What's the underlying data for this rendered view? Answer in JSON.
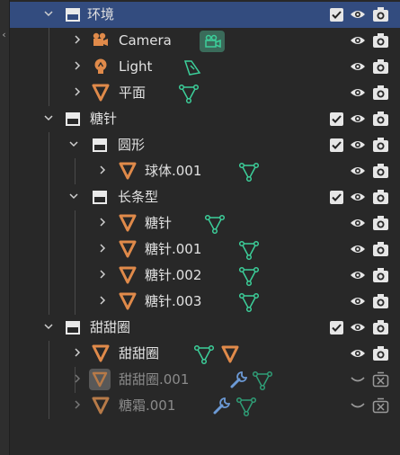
{
  "outliner": {
    "rows": [
      {
        "label": "环境"
      },
      {
        "label": "Camera"
      },
      {
        "label": "Light"
      },
      {
        "label": "平面"
      },
      {
        "label": "糖针"
      },
      {
        "label": "圆形"
      },
      {
        "label": "球体.001"
      },
      {
        "label": "长条型"
      },
      {
        "label": "糖针"
      },
      {
        "label": "糖针.001"
      },
      {
        "label": "糖针.002"
      },
      {
        "label": "糖针.003"
      },
      {
        "label": "甜甜圈"
      },
      {
        "label": "甜甜圈"
      },
      {
        "label": "甜甜圈.001"
      },
      {
        "label": "糖霜.001"
      }
    ]
  },
  "colors": {
    "selection": "#334c7f",
    "object_orange": "#e08a4a",
    "mesh_data_green": "#3ccf9a",
    "camera_data_bg": "#3a6b5a",
    "modifier_blue": "#6c9ad6",
    "icon_white": "#e6e6e6"
  },
  "icons": {
    "collection": "collection-icon",
    "object": "mesh-object-icon",
    "camera": "camera-object-icon",
    "light": "light-object-icon",
    "mesh_data": "mesh-data-icon",
    "modifier": "wrench-icon",
    "visible": "eye-icon",
    "hidden": "eye-closed-icon",
    "render": "camera-render-icon",
    "render_disabled": "camera-render-disabled-icon"
  }
}
